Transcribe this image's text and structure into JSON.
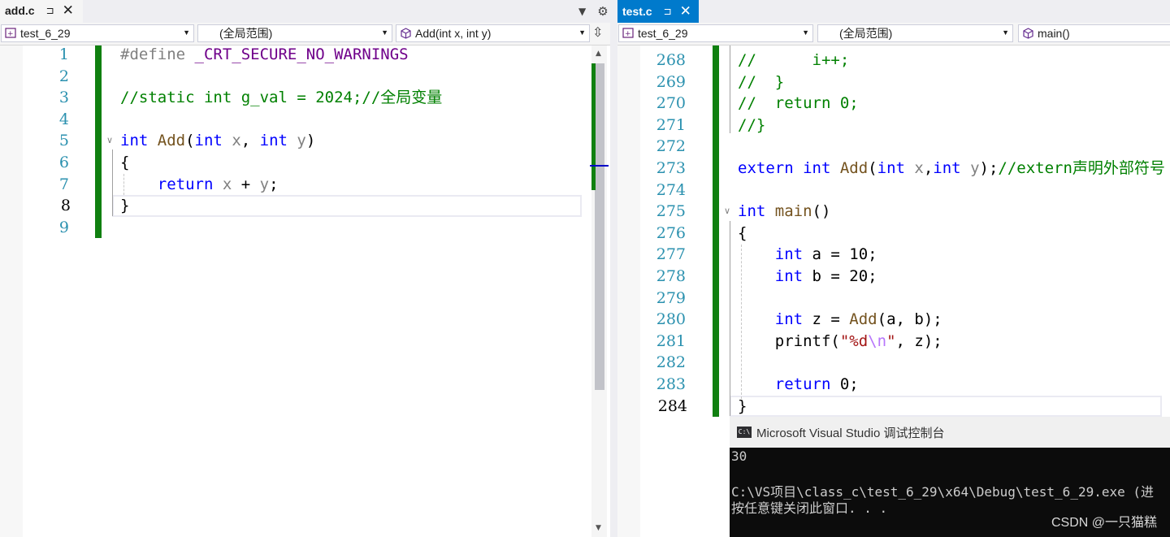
{
  "left": {
    "tab": {
      "title": "add.c",
      "pin": "⊐",
      "close": "✕"
    },
    "nav": {
      "project": "test_6_29",
      "scope": "(全局范围)",
      "member": "Add(int x, int y)"
    },
    "lines": [
      {
        "n": "1",
        "tokens": [
          [
            "pp",
            "#define "
          ],
          [
            "mac",
            "_CRT_SECURE_NO_WARNINGS"
          ]
        ]
      },
      {
        "n": "2",
        "tokens": []
      },
      {
        "n": "3",
        "tokens": [
          [
            "cm",
            "//static int g_val = 2024;//全局变量"
          ]
        ]
      },
      {
        "n": "4",
        "tokens": []
      },
      {
        "n": "5",
        "tokens": [
          [
            "kw",
            "int "
          ],
          [
            "fn",
            "Add"
          ],
          [
            "tx",
            "("
          ],
          [
            "kw",
            "int "
          ],
          [
            "par",
            "x"
          ],
          [
            "tx",
            ", "
          ],
          [
            "kw",
            "int "
          ],
          [
            "par",
            "y"
          ],
          [
            "tx",
            ")"
          ]
        ]
      },
      {
        "n": "6",
        "tokens": [
          [
            "tx",
            "{"
          ]
        ]
      },
      {
        "n": "7",
        "tokens": [
          [
            "tx",
            "    "
          ],
          [
            "kw",
            "return "
          ],
          [
            "par",
            "x"
          ],
          [
            "tx",
            " + "
          ],
          [
            "par",
            "y"
          ],
          [
            "tx",
            ";"
          ]
        ]
      },
      {
        "n": "8",
        "tokens": [
          [
            "tx",
            "}"
          ]
        ]
      },
      {
        "n": "9",
        "tokens": []
      }
    ]
  },
  "right": {
    "tab": {
      "title": "test.c",
      "pin": "⊐",
      "close": "✕"
    },
    "nav": {
      "project": "test_6_29",
      "scope": "(全局范围)",
      "member": "main()"
    },
    "lines": [
      {
        "n": "268",
        "tokens": [
          [
            "cm",
            "//      i++;"
          ]
        ]
      },
      {
        "n": "269",
        "tokens": [
          [
            "cm",
            "//  }"
          ]
        ]
      },
      {
        "n": "270",
        "tokens": [
          [
            "cm",
            "//  return 0;"
          ]
        ]
      },
      {
        "n": "271",
        "tokens": [
          [
            "cm",
            "//}"
          ]
        ]
      },
      {
        "n": "272",
        "tokens": []
      },
      {
        "n": "273",
        "tokens": [
          [
            "kw",
            "extern int "
          ],
          [
            "fn",
            "Add"
          ],
          [
            "tx",
            "("
          ],
          [
            "kw",
            "int "
          ],
          [
            "par",
            "x"
          ],
          [
            "tx",
            ","
          ],
          [
            "kw",
            "int "
          ],
          [
            "par",
            "y"
          ],
          [
            "tx",
            ");"
          ],
          [
            "cm",
            "//extern声明外部符号"
          ]
        ]
      },
      {
        "n": "274",
        "tokens": []
      },
      {
        "n": "275",
        "tokens": [
          [
            "kw",
            "int "
          ],
          [
            "fn",
            "main"
          ],
          [
            "tx",
            "()"
          ]
        ]
      },
      {
        "n": "276",
        "tokens": [
          [
            "tx",
            "{"
          ]
        ]
      },
      {
        "n": "277",
        "tokens": [
          [
            "tx",
            "    "
          ],
          [
            "kw",
            "int "
          ],
          [
            "tx",
            "a = 10;"
          ]
        ]
      },
      {
        "n": "278",
        "tokens": [
          [
            "tx",
            "    "
          ],
          [
            "kw",
            "int "
          ],
          [
            "tx",
            "b = 20;"
          ]
        ]
      },
      {
        "n": "279",
        "tokens": []
      },
      {
        "n": "280",
        "tokens": [
          [
            "tx",
            "    "
          ],
          [
            "kw",
            "int "
          ],
          [
            "tx",
            "z = "
          ],
          [
            "fn",
            "Add"
          ],
          [
            "tx",
            "(a, b);"
          ]
        ]
      },
      {
        "n": "281",
        "tokens": [
          [
            "tx",
            "    printf("
          ],
          [
            "str",
            "\"%d"
          ],
          [
            "esc",
            "\\n"
          ],
          [
            "str",
            "\""
          ],
          [
            "tx",
            ", z);"
          ]
        ]
      },
      {
        "n": "282",
        "tokens": []
      },
      {
        "n": "283",
        "tokens": [
          [
            "tx",
            "    "
          ],
          [
            "kw",
            "return "
          ],
          [
            "tx",
            "0;"
          ]
        ]
      },
      {
        "n": "284",
        "tokens": [
          [
            "tx",
            "}"
          ]
        ]
      }
    ]
  },
  "console": {
    "title": "Microsoft Visual Studio 调试控制台",
    "icon_label": "C:\\",
    "output": "30",
    "path_line": "C:\\VS项目\\class_c\\test_6_29\\x64\\Debug\\test_6_29.exe (进",
    "prompt_line": "按任意键关闭此窗口. . ."
  },
  "watermark": "CSDN @一只猫糕",
  "colors": {
    "accent": "#007acc",
    "keyword": "#0000ff",
    "comment": "#008000",
    "changebar": "#108010"
  }
}
